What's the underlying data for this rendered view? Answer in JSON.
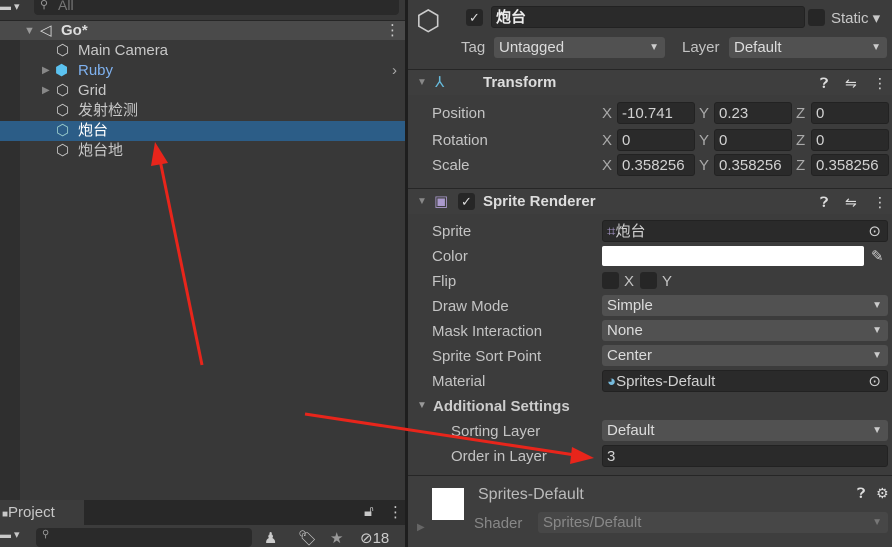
{
  "hierarchy": {
    "search_placeholder": "All",
    "scene": "Go*",
    "items": [
      {
        "label": "Main Camera",
        "expandable": false
      },
      {
        "label": "Ruby",
        "expandable": true,
        "prefab": true
      },
      {
        "label": "Grid",
        "expandable": true
      },
      {
        "label": "发射检测",
        "expandable": false
      },
      {
        "label": "炮台",
        "expandable": false,
        "selected": true
      },
      {
        "label": "炮台地",
        "expandable": false
      }
    ]
  },
  "project": {
    "tab": "Project",
    "hidden_count": "18"
  },
  "inspector": {
    "name": "炮台",
    "static_label": "Static",
    "tag_label": "Tag",
    "tag": "Untagged",
    "layer_label": "Layer",
    "layer": "Default",
    "transform": {
      "title": "Transform",
      "rows": [
        {
          "label": "Position",
          "x": "-10.741",
          "y": "0.23",
          "z": "0"
        },
        {
          "label": "Rotation",
          "x": "0",
          "y": "0",
          "z": "0"
        },
        {
          "label": "Scale",
          "x": "0.358256",
          "y": "0.358256",
          "z": "0.358256"
        }
      ],
      "axes": [
        "X",
        "Y",
        "Z"
      ]
    },
    "sprite_renderer": {
      "title": "Sprite Renderer",
      "sprite_label": "Sprite",
      "sprite": "炮台",
      "color_label": "Color",
      "color": "#ffffff",
      "flip_label": "Flip",
      "flip_x": "X",
      "flip_y": "Y",
      "draw_mode_label": "Draw Mode",
      "draw_mode": "Simple",
      "mask_label": "Mask Interaction",
      "mask": "None",
      "sort_point_label": "Sprite Sort Point",
      "sort_point": "Center",
      "material_label": "Material",
      "material": "Sprites-Default",
      "additional": "Additional Settings",
      "sorting_layer_label": "Sorting Layer",
      "sorting_layer": "Default",
      "order_label": "Order in Layer",
      "order": "3"
    },
    "material": {
      "name": "Sprites-Default",
      "shader_label": "Shader",
      "shader": "Sprites/Default"
    }
  },
  "colors": {
    "selection": "#2c5d87",
    "annotation_arrow": "#e8251b",
    "ruby": "#7fb2f0"
  }
}
